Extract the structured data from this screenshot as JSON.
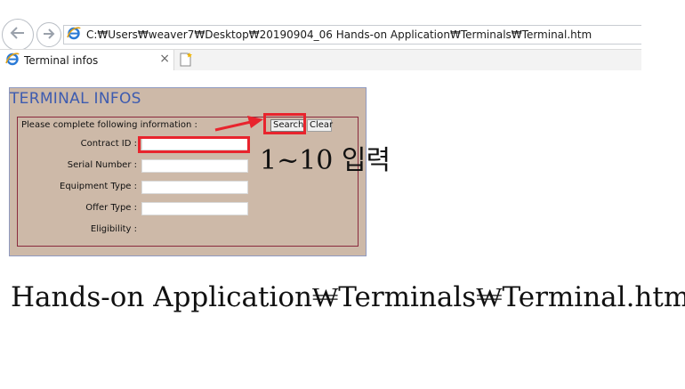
{
  "browser": {
    "address": "C:₩Users₩weaver7₩Desktop₩20190904_06 Hands-on Application₩Terminals₩Terminal.htm",
    "tab_title": "Terminal infos",
    "tab_close": "×"
  },
  "form": {
    "title": "TERMINAL INFOS",
    "instruction": "Please complete following information :",
    "search_label": "Search",
    "clear_label": "Clear",
    "fields": [
      {
        "label": "Contract ID :",
        "value": ""
      },
      {
        "label": "Serial Number :",
        "value": ""
      },
      {
        "label": "Equipment Type :",
        "value": ""
      },
      {
        "label": "Offer Type :",
        "value": ""
      },
      {
        "label": "Eligibility :"
      }
    ]
  },
  "annotation": {
    "note": "1~10 입력",
    "highlight_color": "#e8242d"
  },
  "caption": "Hands-on Application₩Terminals₩Terminal.htm"
}
